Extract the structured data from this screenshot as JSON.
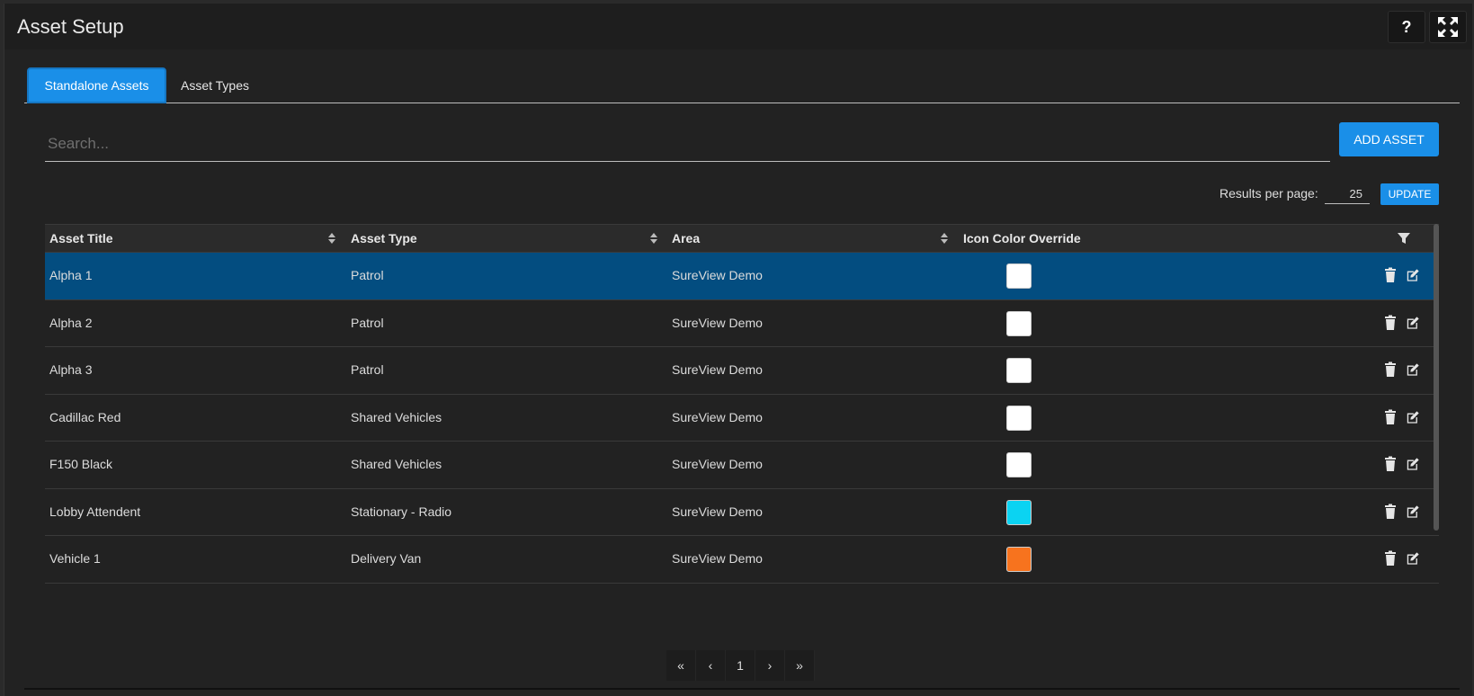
{
  "window": {
    "title": "Asset Setup",
    "help_label": "?"
  },
  "tabs": [
    {
      "label": "Standalone Assets",
      "active": true
    },
    {
      "label": "Asset Types",
      "active": false
    }
  ],
  "search": {
    "placeholder": "Search...",
    "value": ""
  },
  "add_button": "ADD ASSET",
  "pagination_size": {
    "label": "Results per page:",
    "value": "25",
    "button": "UPDATE"
  },
  "table": {
    "headers": [
      "Asset Title",
      "Asset Type",
      "Area",
      "Icon Color Override"
    ],
    "rows": [
      {
        "title": "Alpha 1",
        "type": "Patrol",
        "area": "SureView Demo",
        "color": "#ffffff",
        "selected": true
      },
      {
        "title": "Alpha 2",
        "type": "Patrol",
        "area": "SureView Demo",
        "color": "#ffffff",
        "selected": false
      },
      {
        "title": "Alpha 3",
        "type": "Patrol",
        "area": "SureView Demo",
        "color": "#ffffff",
        "selected": false
      },
      {
        "title": "Cadillac Red",
        "type": "Shared Vehicles",
        "area": "SureView Demo",
        "color": "#ffffff",
        "selected": false
      },
      {
        "title": "F150 Black",
        "type": "Shared Vehicles",
        "area": "SureView Demo",
        "color": "#ffffff",
        "selected": false
      },
      {
        "title": "Lobby Attendent",
        "type": "Stationary - Radio",
        "area": "SureView Demo",
        "color": "#0bd3f2",
        "selected": false
      },
      {
        "title": "Vehicle 1",
        "type": "Delivery Van",
        "area": "SureView Demo",
        "color": "#f7731e",
        "selected": false
      }
    ]
  },
  "pager": {
    "first": "«",
    "prev": "‹",
    "page": "1",
    "next": "›",
    "last": "»"
  },
  "colors": {
    "accent": "#1a8fe8",
    "selected_row": "#034d80"
  },
  "icons": {
    "delete": "trash-icon",
    "edit": "edit-icon",
    "filter": "filter-icon",
    "fullscreen": "fullscreen-icon"
  }
}
